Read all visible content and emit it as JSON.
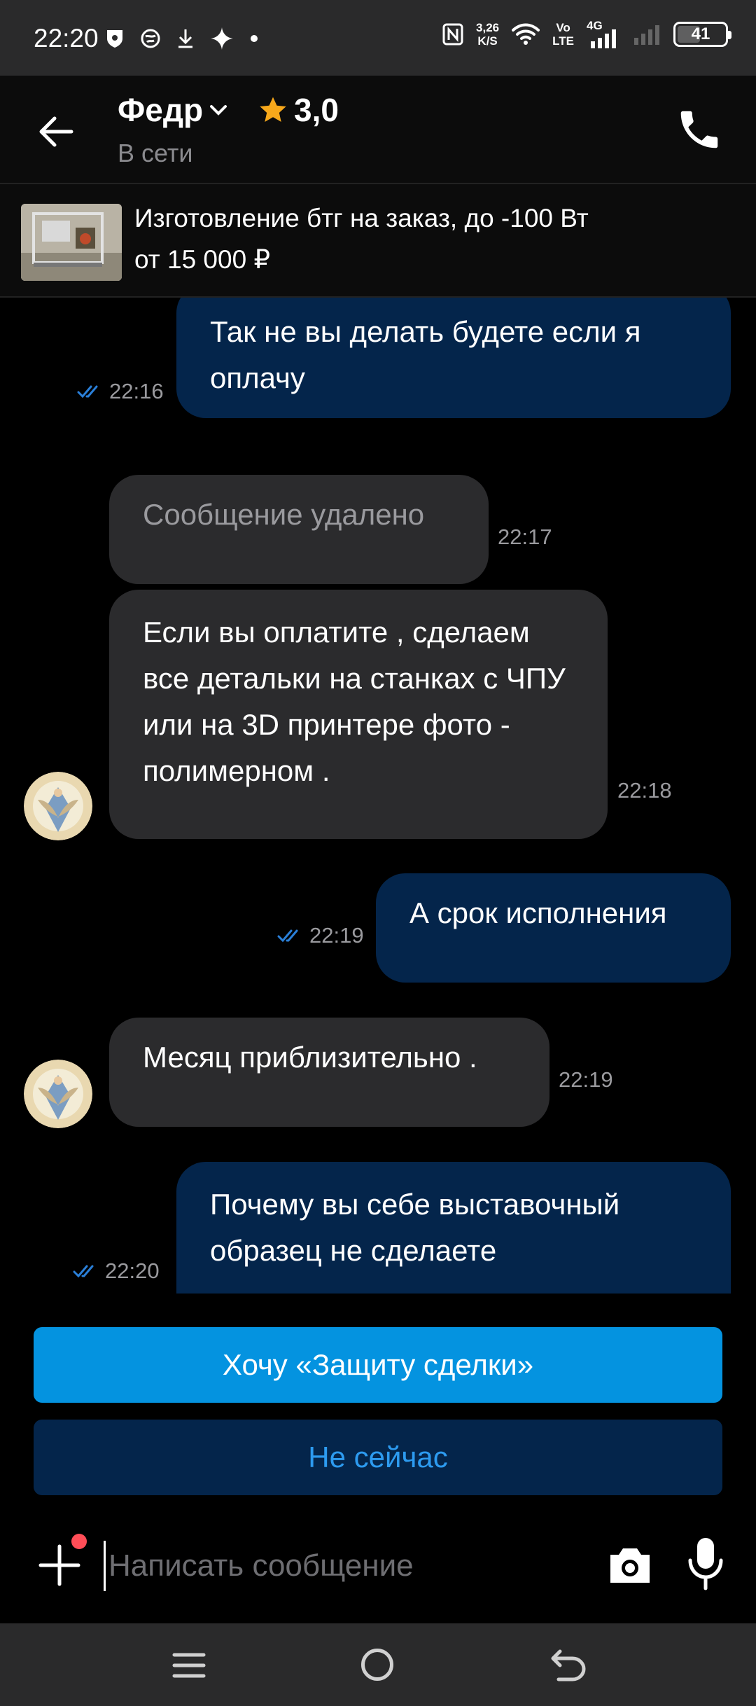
{
  "status_bar": {
    "time": "22:20",
    "net_speed_value": "3,26",
    "net_speed_unit": "K/S",
    "volte_top": "Vo",
    "volte_bottom": "LTE",
    "network": "4G",
    "battery": "41"
  },
  "header": {
    "contact_name": "Федр",
    "rating": "3,0",
    "presence": "В сети"
  },
  "listing": {
    "title": "Изготовление бтг на заказ, до -100 Вт",
    "price": "от 15 000 ₽"
  },
  "messages": [
    {
      "direction": "out",
      "text": "Так не вы делать будете если я оплачу",
      "time": "22:16",
      "read": true
    },
    {
      "direction": "in",
      "text": "Сообщение удалено",
      "time": "22:17",
      "deleted": true
    },
    {
      "direction": "in",
      "text": "Если вы оплатите , сделаем все детальки на станках с ЧПУ или на 3D принтере фото - полимерном .",
      "time": "22:18"
    },
    {
      "direction": "out",
      "text": "А срок исполнения",
      "time": "22:19",
      "read": true
    },
    {
      "direction": "in",
      "text": "Месяц приблизительно .",
      "time": "22:19"
    },
    {
      "direction": "out",
      "text": "Почему вы себе выставочный образец не сделаете",
      "time": "22:20",
      "read": true
    }
  ],
  "actions": {
    "primary": "Хочу «Защиту сделки»",
    "secondary": "Не сейчас"
  },
  "composer": {
    "placeholder": "Написать сообщение",
    "value": ""
  },
  "colors": {
    "accent": "#0493e0",
    "outgoing_bubble": "#04254b",
    "incoming_bubble": "#2b2b2d",
    "read_check": "#2a7fd8",
    "star": "#f7a81b",
    "notification_dot": "#ff4d57"
  },
  "icons": {
    "back": "arrow-left-icon",
    "call": "phone-icon",
    "add": "plus-icon",
    "camera": "camera-icon",
    "mic": "microphone-icon",
    "read": "double-check-icon"
  }
}
